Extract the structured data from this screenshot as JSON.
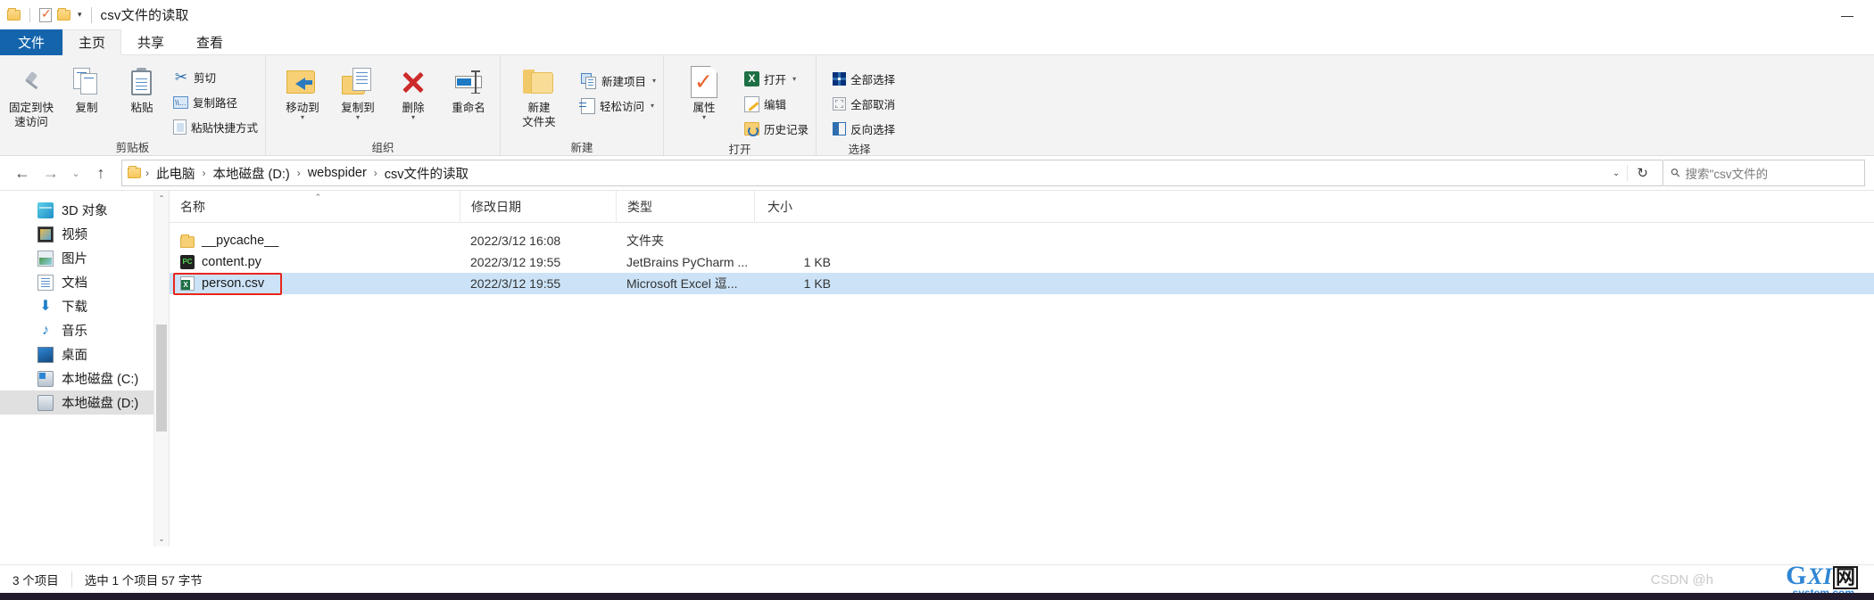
{
  "titlebar": {
    "title": "csv文件的读取",
    "quick_access": [
      {
        "name": "folder-icon",
        "label": ""
      },
      {
        "name": "properties-icon",
        "label": ""
      },
      {
        "name": "new-folder-icon",
        "label": ""
      }
    ],
    "customize_caret": "▾",
    "minimize": "—"
  },
  "tabs": [
    {
      "id": "file",
      "label": "文件"
    },
    {
      "id": "home",
      "label": "主页"
    },
    {
      "id": "share",
      "label": "共享"
    },
    {
      "id": "view",
      "label": "查看"
    }
  ],
  "ribbon": {
    "groups": [
      {
        "title": "剪贴板",
        "big": [
          {
            "label": "固定到快\n速访问",
            "icon": "pin-icon",
            "line1": "固定到快",
            "line2": "速访问"
          },
          {
            "label": "复制",
            "icon": "copy-icon",
            "line1": "复制",
            "line2": ""
          },
          {
            "label": "粘贴",
            "icon": "paste-icon",
            "line1": "粘贴",
            "line2": ""
          }
        ],
        "small": [
          {
            "label": "剪切",
            "icon": "scissors-icon",
            "caret": false
          },
          {
            "label": "复制路径",
            "icon": "copy-path-icon",
            "caret": false
          },
          {
            "label": "粘贴快捷方式",
            "icon": "paste-shortcut-icon",
            "caret": false
          }
        ]
      },
      {
        "title": "组织",
        "big": [
          {
            "line1": "移动到",
            "line2": "",
            "icon": "move-to-icon",
            "caret": "▾"
          },
          {
            "line1": "复制到",
            "line2": "",
            "icon": "copy-to-icon",
            "caret": "▾"
          },
          {
            "line1": "删除",
            "line2": "",
            "icon": "delete-icon",
            "caret": "▾"
          },
          {
            "line1": "重命名",
            "line2": "",
            "icon": "rename-icon",
            "caret": ""
          }
        ],
        "small": []
      },
      {
        "title": "新建",
        "big": [
          {
            "line1": "新建",
            "line2": "文件夹",
            "icon": "new-folder-icon",
            "caret": ""
          }
        ],
        "small": [
          {
            "label": "新建项目",
            "icon": "new-item-icon",
            "caret": true
          },
          {
            "label": "轻松访问",
            "icon": "easy-access-icon",
            "caret": true
          }
        ]
      },
      {
        "title": "打开",
        "big": [
          {
            "line1": "属性",
            "line2": "",
            "icon": "properties-icon",
            "caret": "▾"
          }
        ],
        "small": [
          {
            "label": "打开",
            "icon": "excel-icon",
            "caret": true
          },
          {
            "label": "编辑",
            "icon": "edit-icon",
            "caret": false
          },
          {
            "label": "历史记录",
            "icon": "history-icon",
            "caret": false
          }
        ]
      },
      {
        "title": "选择",
        "big": [],
        "small": [
          {
            "label": "全部选择",
            "icon": "select-all-icon",
            "caret": false
          },
          {
            "label": "全部取消",
            "icon": "select-none-icon",
            "caret": false
          },
          {
            "label": "反向选择",
            "icon": "invert-selection-icon",
            "caret": false
          }
        ]
      }
    ]
  },
  "address": {
    "back": "←",
    "forward": "→",
    "recent": "⌄",
    "up": "↑",
    "crumbs": [
      "此电脑",
      "本地磁盘 (D:)",
      "webspider",
      "csv文件的读取"
    ],
    "separator": "›",
    "dropdown_caret": "⌄",
    "refresh": "↻",
    "search_placeholder": "搜索\"csv文件的"
  },
  "navpane": {
    "items": [
      {
        "label": "3D 对象",
        "icon": "3d-objects-icon",
        "selected": false
      },
      {
        "label": "视频",
        "icon": "videos-icon",
        "selected": false
      },
      {
        "label": "图片",
        "icon": "pictures-icon",
        "selected": false
      },
      {
        "label": "文档",
        "icon": "documents-icon",
        "selected": false
      },
      {
        "label": "下载",
        "icon": "downloads-icon",
        "selected": false
      },
      {
        "label": "音乐",
        "icon": "music-icon",
        "selected": false
      },
      {
        "label": "桌面",
        "icon": "desktop-icon",
        "selected": false
      },
      {
        "label": "本地磁盘 (C:)",
        "icon": "drive-c-icon",
        "selected": false
      },
      {
        "label": "本地磁盘 (D:)",
        "icon": "drive-d-icon",
        "selected": true
      }
    ],
    "scroll_up": "⌃",
    "scroll_down": "⌄"
  },
  "filelist": {
    "columns": [
      {
        "key": "name",
        "label": "名称",
        "sorted": true,
        "sort_mark": "⌃"
      },
      {
        "key": "date",
        "label": "修改日期"
      },
      {
        "key": "type",
        "label": "类型"
      },
      {
        "key": "size",
        "label": "大小"
      }
    ],
    "rows": [
      {
        "name": "__pycache__",
        "icon": "folder-icon",
        "date": "2022/3/12 16:08",
        "type": "文件夹",
        "size": "",
        "selected": false,
        "annotated": false
      },
      {
        "name": "content.py",
        "icon": "python-file-icon",
        "date": "2022/3/12 19:55",
        "type": "JetBrains PyCharm ...",
        "size": "1 KB",
        "selected": false,
        "annotated": false
      },
      {
        "name": "person.csv",
        "icon": "csv-file-icon",
        "date": "2022/3/12 19:55",
        "type": "Microsoft Excel 逗...",
        "size": "1 KB",
        "selected": true,
        "annotated": true
      }
    ]
  },
  "statusbar": {
    "item_count": "3 个项目",
    "selection_info": "选中 1 个项目  57 字节"
  },
  "watermark": {
    "csdn": "CSDN @h",
    "logo_g": "G",
    "logo_xi": "XI",
    "logo_wang": "网",
    "logo_sub": "system.com"
  },
  "colors": {
    "accent": "#1464ac",
    "selection": "#cce3f7",
    "annotation": "#e8261c"
  }
}
